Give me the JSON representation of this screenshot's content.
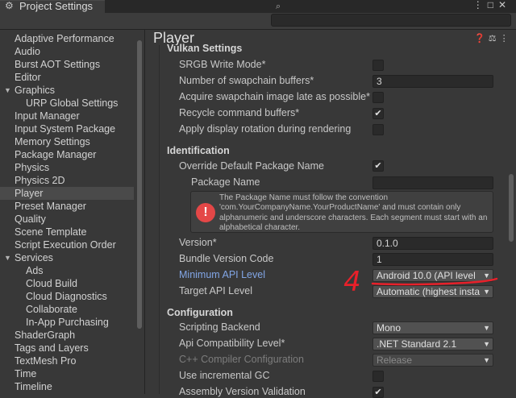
{
  "window": {
    "title": "Project Settings"
  },
  "search": {
    "placeholder": ""
  },
  "sidebar": {
    "items": [
      {
        "label": "Adaptive Performance"
      },
      {
        "label": "Audio"
      },
      {
        "label": "Burst AOT Settings"
      },
      {
        "label": "Editor"
      },
      {
        "label": "Graphics",
        "expanded": true
      },
      {
        "label": "URP Global Settings",
        "child": true
      },
      {
        "label": "Input Manager"
      },
      {
        "label": "Input System Package"
      },
      {
        "label": "Memory Settings"
      },
      {
        "label": "Package Manager"
      },
      {
        "label": "Physics"
      },
      {
        "label": "Physics 2D"
      },
      {
        "label": "Player",
        "selected": true
      },
      {
        "label": "Preset Manager"
      },
      {
        "label": "Quality"
      },
      {
        "label": "Scene Template"
      },
      {
        "label": "Script Execution Order"
      },
      {
        "label": "Services",
        "expanded": true
      },
      {
        "label": "Ads",
        "child": true
      },
      {
        "label": "Cloud Build",
        "child": true
      },
      {
        "label": "Cloud Diagnostics",
        "child": true
      },
      {
        "label": "Collaborate",
        "child": true
      },
      {
        "label": "In-App Purchasing",
        "child": true
      },
      {
        "label": "ShaderGraph"
      },
      {
        "label": "Tags and Layers"
      },
      {
        "label": "TextMesh Pro"
      },
      {
        "label": "Time"
      },
      {
        "label": "Timeline"
      }
    ]
  },
  "header": {
    "title": "Player"
  },
  "vulkan": {
    "heading": "Vulkan Settings",
    "srgb_label": "SRGB Write Mode*",
    "srgb_checked": false,
    "swapchain_label": "Number of swapchain buffers*",
    "swapchain_value": "3",
    "acquire_label": "Acquire swapchain image late as possible*",
    "acquire_checked": false,
    "recycle_label": "Recycle command buffers*",
    "recycle_checked": true,
    "rotation_label": "Apply display rotation during rendering",
    "rotation_checked": false
  },
  "identification": {
    "heading": "Identification",
    "override_label": "Override Default Package Name",
    "override_checked": true,
    "package_name_label": "Package Name",
    "package_name_value": "",
    "warning_text": "The Package Name must follow the convention 'com.YourCompanyName.YourProductName' and must contain only alphanumeric and underscore characters. Each segment must start with an alphabetical character.",
    "version_label": "Version*",
    "version_value": "0.1.0",
    "bundle_label": "Bundle Version Code",
    "bundle_value": "1",
    "min_api_label": "Minimum API Level",
    "min_api_value": "Android 10.0 (API level",
    "target_api_label": "Target API Level",
    "target_api_value": "Automatic (highest insta"
  },
  "configuration": {
    "heading": "Configuration",
    "backend_label": "Scripting Backend",
    "backend_value": "Mono",
    "api_compat_label": "Api Compatibility Level*",
    "api_compat_value": ".NET Standard 2.1",
    "cpp_label": "C++ Compiler Configuration",
    "cpp_value": "Release",
    "incremental_label": "Use incremental GC",
    "incremental_checked": false,
    "assembly_label": "Assembly Version Validation",
    "assembly_checked": true
  },
  "annotation": {
    "text": "4",
    "color": "#e8202a"
  },
  "colors": {
    "background": "#383838",
    "selected": "#4a4a4a",
    "link": "#82a6e6",
    "error": "#e44747"
  }
}
